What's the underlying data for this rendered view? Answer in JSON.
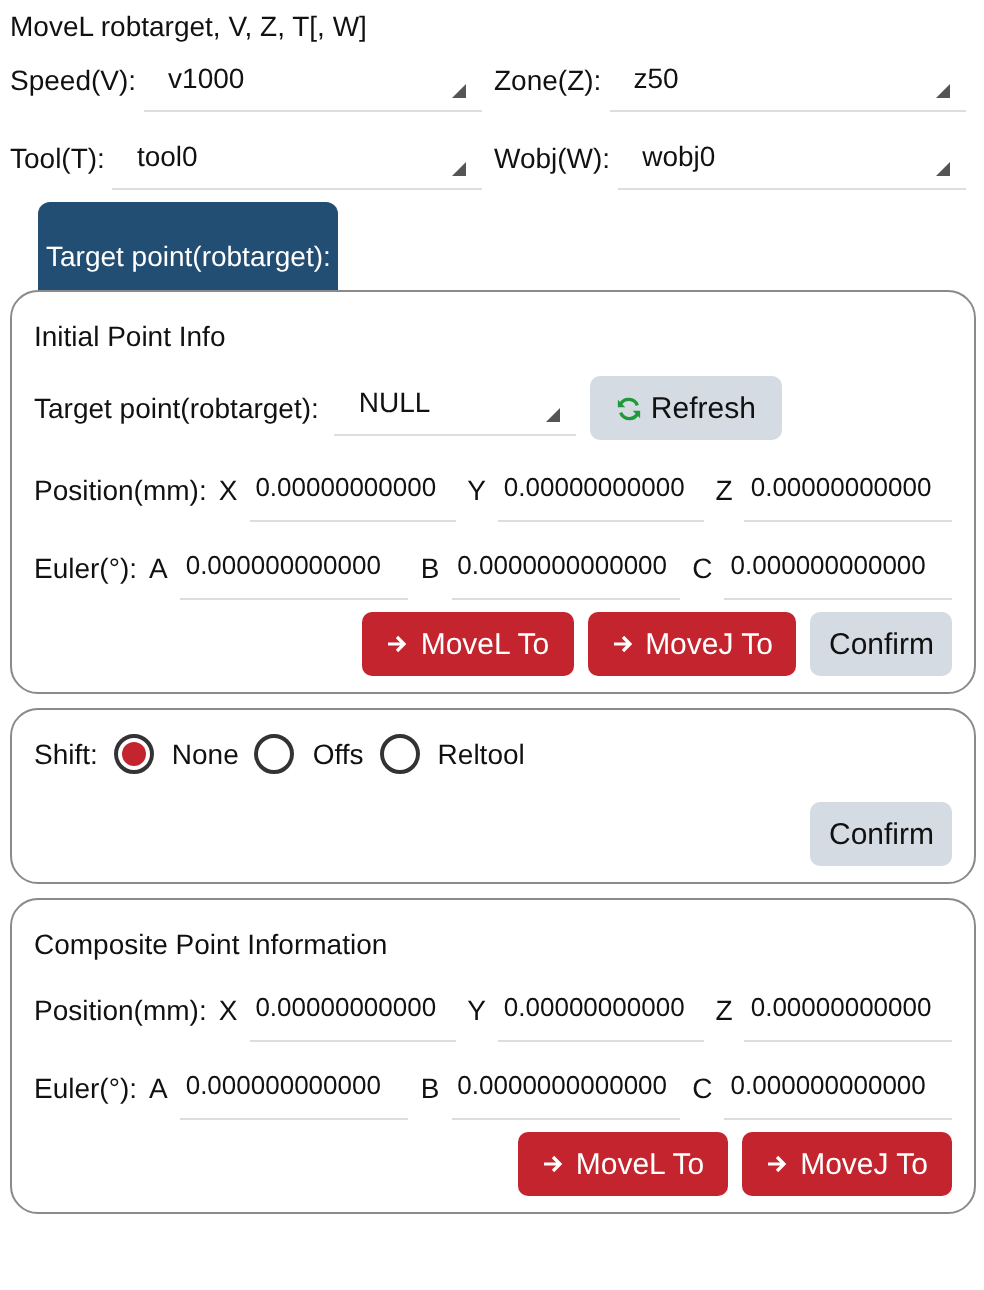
{
  "title": "MoveL robtarget, V, Z, T[, W]",
  "params": [
    {
      "label": "Speed(V):",
      "value": "v1000"
    },
    {
      "label": "Zone(Z):",
      "value": "z50"
    },
    {
      "label": "Tool(T):",
      "value": "tool0"
    },
    {
      "label": "Wobj(W):",
      "value": "wobj0"
    }
  ],
  "tabs": [
    {
      "label": "Target point(robtarget):",
      "selected": true
    }
  ],
  "initial_point": {
    "title": "Initial Point Info",
    "target": {
      "label": "Target point(robtarget):",
      "value": "NULL"
    },
    "refresh_button": "Refresh",
    "position": {
      "label": "Position(mm):",
      "fields": [
        {
          "axis": "X",
          "value": "0.00000000000"
        },
        {
          "axis": "Y",
          "value": "0.00000000000"
        },
        {
          "axis": "Z",
          "value": "0.00000000000"
        }
      ]
    },
    "euler": {
      "label": "Euler(°):",
      "fields": [
        {
          "axis": "A",
          "value": "0.000000000000"
        },
        {
          "axis": "B",
          "value": "0.0000000000000"
        },
        {
          "axis": "C",
          "value": "0.000000000000"
        }
      ]
    },
    "buttons": [
      {
        "kind": "move",
        "label": "MoveL To"
      },
      {
        "kind": "move",
        "label": "MoveJ To"
      },
      {
        "kind": "confirm",
        "label": "Confirm"
      }
    ]
  },
  "shift": {
    "label": "Shift:",
    "options": [
      {
        "label": "None",
        "selected": true
      },
      {
        "label": "Offs",
        "selected": false
      },
      {
        "label": "Reltool",
        "selected": false
      }
    ],
    "confirm_button": "Confirm"
  },
  "composite_point": {
    "title": "Composite Point Information",
    "position": {
      "label": "Position(mm):",
      "fields": [
        {
          "axis": "X",
          "value": "0.00000000000"
        },
        {
          "axis": "Y",
          "value": "0.00000000000"
        },
        {
          "axis": "Z",
          "value": "0.00000000000"
        }
      ]
    },
    "euler": {
      "label": "Euler(°):",
      "fields": [
        {
          "axis": "A",
          "value": "0.000000000000"
        },
        {
          "axis": "B",
          "value": "0.0000000000000"
        },
        {
          "axis": "C",
          "value": "0.000000000000"
        }
      ]
    },
    "buttons": [
      {
        "kind": "move",
        "label": "MoveL To"
      },
      {
        "kind": "move",
        "label": "MoveJ To"
      }
    ]
  }
}
